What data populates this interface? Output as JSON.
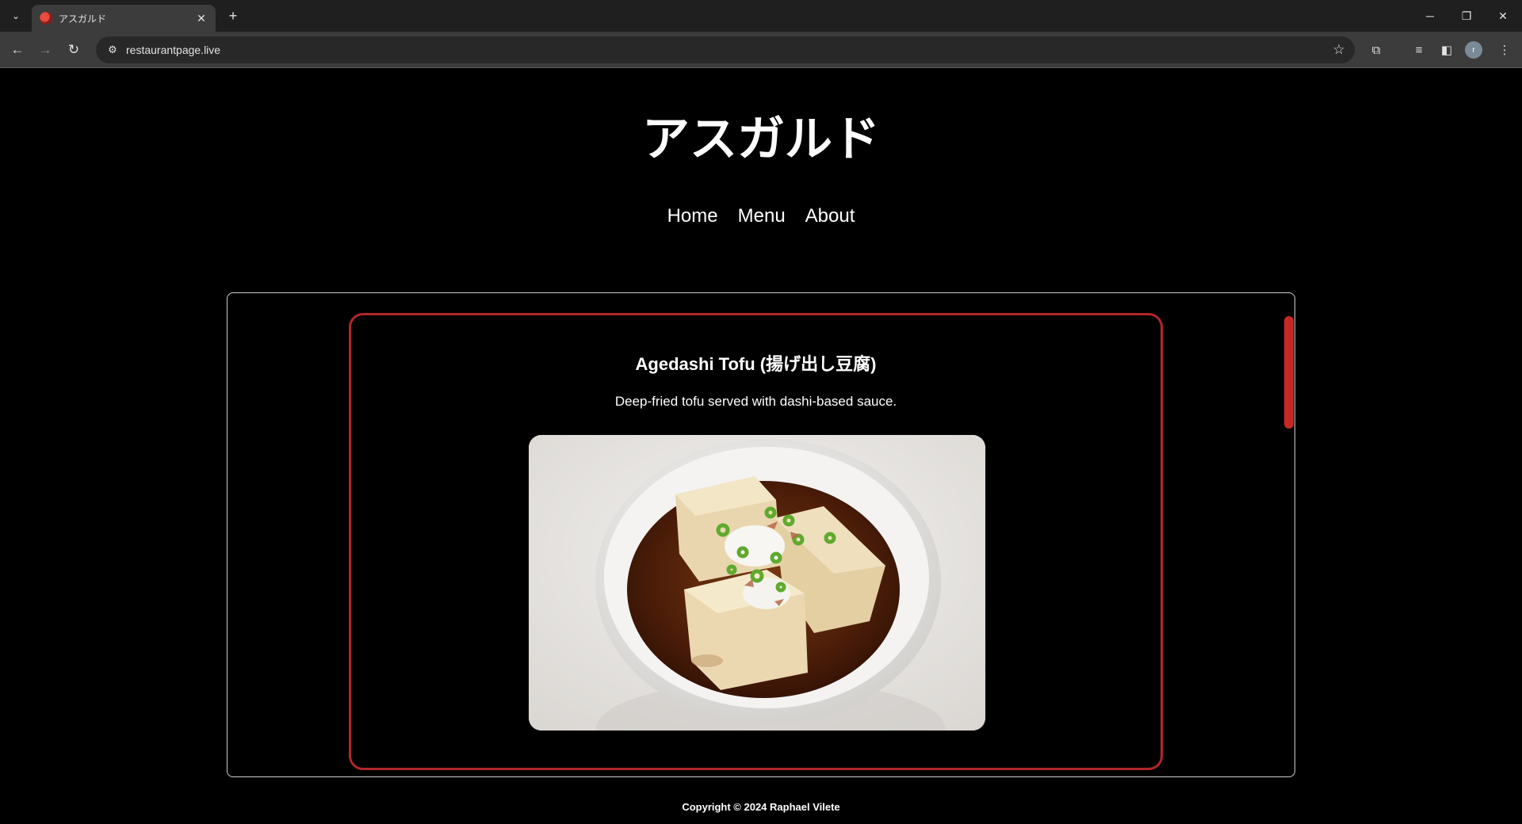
{
  "browser": {
    "tab_title": "アスガルド",
    "url": "restaurantpage.live",
    "avatar_initial": "r"
  },
  "site": {
    "title": "アスガルド",
    "nav": [
      "Home",
      "Menu",
      "About"
    ]
  },
  "menu_item": {
    "name": "Agedashi Tofu (揚げ出し豆腐)",
    "description": "Deep-fried tofu served with dashi-based sauce."
  },
  "footer": {
    "copyright": "Copyright © 2024 Raphael Vilete"
  },
  "colors": {
    "accent": "#b3262a",
    "scrollbar": "#c62828",
    "background": "#000000"
  }
}
